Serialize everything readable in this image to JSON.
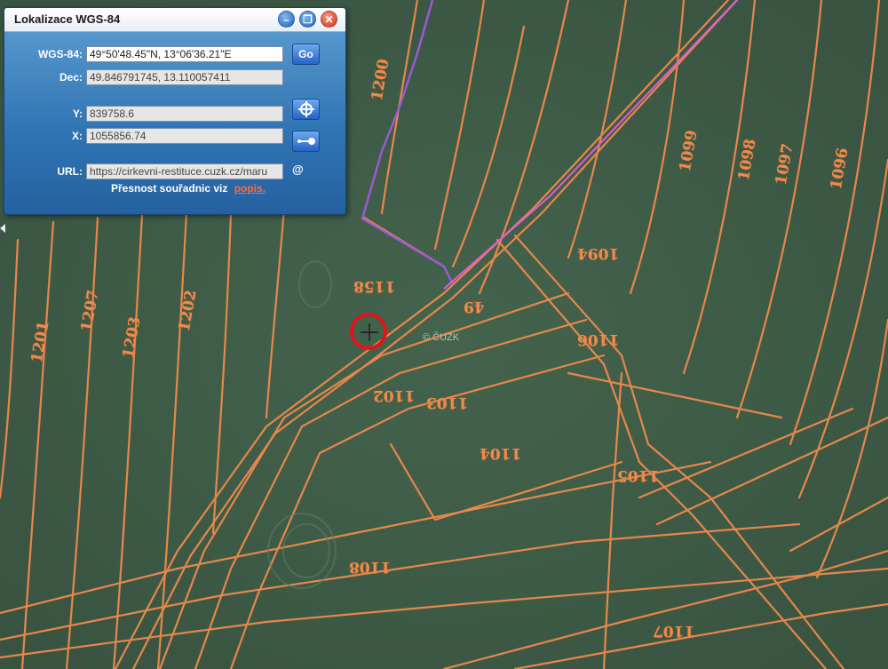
{
  "dialog": {
    "title": "Lokalizace WGS-84",
    "wgs_label": "WGS-84:",
    "wgs_value": "49°50'48.45\"N, 13°06'36.21\"E",
    "go_label": "Go",
    "dec_label": "Dec:",
    "dec_value": "49.846791745, 13.110057411",
    "y_label": "Y:",
    "y_value": "839758.6",
    "x_label": "X:",
    "x_value": "1055856.74",
    "url_label": "URL:",
    "url_value": "https://cirkevni-restituce.cuzk.cz/maru",
    "at": "@",
    "precision_text": "Přesnost souřadnic viz",
    "precision_link": "popis."
  },
  "map": {
    "copyright": "© ČUZK",
    "parcel_labels": [
      {
        "text": "1200"
      },
      {
        "text": "1098"
      },
      {
        "text": "1097"
      },
      {
        "text": "1096"
      },
      {
        "text": "1099"
      },
      {
        "text": "1094"
      },
      {
        "text": "1158"
      },
      {
        "text": "1102"
      },
      {
        "text": "1103"
      },
      {
        "text": "1104"
      },
      {
        "text": "1105"
      },
      {
        "text": "1106"
      },
      {
        "text": "1107"
      },
      {
        "text": "1108"
      },
      {
        "text": "49"
      },
      {
        "text": "1207"
      },
      {
        "text": "1203"
      },
      {
        "text": "1202"
      },
      {
        "text": "1201"
      }
    ],
    "line_color": "#f08a4b",
    "boundary_color": "#9b59d6"
  }
}
